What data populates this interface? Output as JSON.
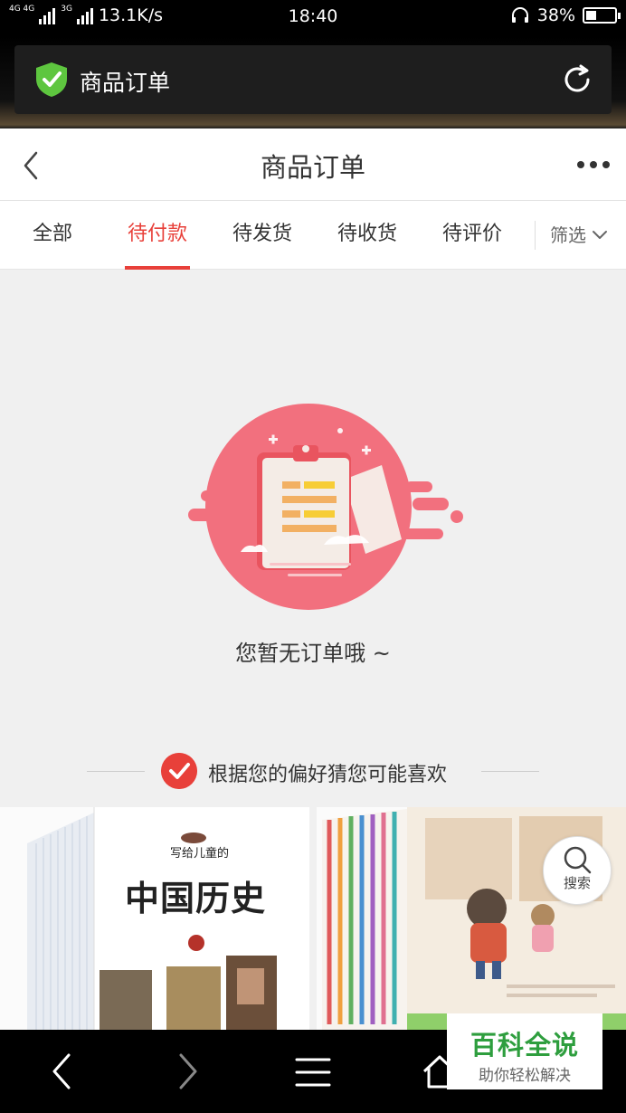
{
  "status_bar": {
    "network_tag_1": "4G 4G",
    "network_tag_2": "3G",
    "speed": "13.1K/s",
    "time": "18:40",
    "battery": "38%",
    "battery_level": 0.38
  },
  "browser_bar": {
    "title": "商品订单"
  },
  "header": {
    "title": "商品订单"
  },
  "tabs": [
    {
      "label": "全部",
      "active": false
    },
    {
      "label": "待付款",
      "active": true
    },
    {
      "label": "待发货",
      "active": false
    },
    {
      "label": "待收货",
      "active": false
    },
    {
      "label": "待评价",
      "active": false
    }
  ],
  "filter": {
    "label": "筛选"
  },
  "empty_state": {
    "message": "您暂无订单哦 ~"
  },
  "recommend": {
    "title": "根据您的偏好猜您可能喜欢"
  },
  "products": [
    {
      "small_title": "写给儿童的",
      "big_title": "中国历史"
    },
    {}
  ],
  "search_float": {
    "label": "搜索"
  },
  "watermark": {
    "title": "百科全说",
    "subtitle": "助你轻松解决"
  },
  "colors": {
    "accent": "#e8403a",
    "shield_green": "#5ec63f",
    "watermark_green": "#2e9e3e"
  }
}
